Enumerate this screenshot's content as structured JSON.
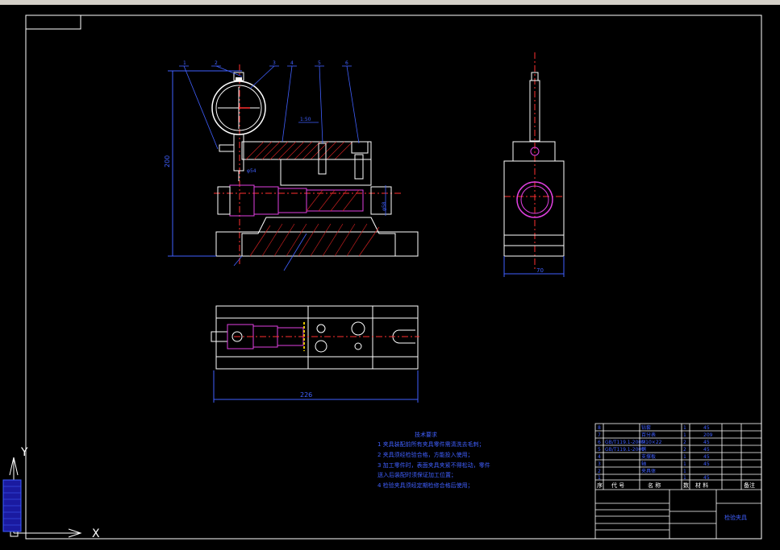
{
  "drawing": {
    "dimensions": {
      "height_front": "200",
      "width_top": "226",
      "width_side": "70",
      "diameter_bore": "φ58",
      "hole_label": "φ54",
      "small_note": "1:50"
    },
    "balloons": [
      "1",
      "2",
      "3",
      "4",
      "5",
      "6"
    ],
    "tech_requirements": {
      "title": "技术要求",
      "items": [
        "1  夹具装配前所有夹具零件需清洗去毛刺；",
        "2  夹具须经检验合格，方能投入使用；",
        "3  加工零件时，表面夹具夹紧不得松动，零件",
        "    送入后装配时须保证加工位置；",
        "4  检验夹具须经定期检修合格后使用；"
      ]
    },
    "bom": {
      "rows": [
        {
          "no": "8",
          "code": "",
          "name": "钻套",
          "qty": "1",
          "mat": "45",
          "note": ""
        },
        {
          "no": "7",
          "code": "",
          "name": "百分表",
          "qty": "1",
          "mat": "209",
          "note": ""
        },
        {
          "no": "6",
          "code": "GB/T119.1-2000",
          "name": "M10×22",
          "qty": "2",
          "mat": "45",
          "note": ""
        },
        {
          "no": "5",
          "code": "GB/T119.1-2000",
          "name": "销",
          "qty": "2",
          "mat": "45",
          "note": ""
        },
        {
          "no": "4",
          "code": "",
          "name": "支撑板",
          "qty": "1",
          "mat": "45",
          "note": ""
        },
        {
          "no": "3",
          "code": "",
          "name": "轴",
          "qty": "1",
          "mat": "45",
          "note": ""
        },
        {
          "no": "2",
          "code": "",
          "name": "夹具体",
          "qty": "1",
          "mat": "",
          "note": ""
        },
        {
          "no": "1",
          "code": "",
          "name": "",
          "qty": "1",
          "mat": "45",
          "note": ""
        }
      ],
      "header": [
        "序",
        "代  号",
        "名  称",
        "数",
        "材 料",
        "备注"
      ],
      "title_block": "检验夹具"
    },
    "ucs": {
      "x": "X",
      "y": "Y"
    }
  }
}
